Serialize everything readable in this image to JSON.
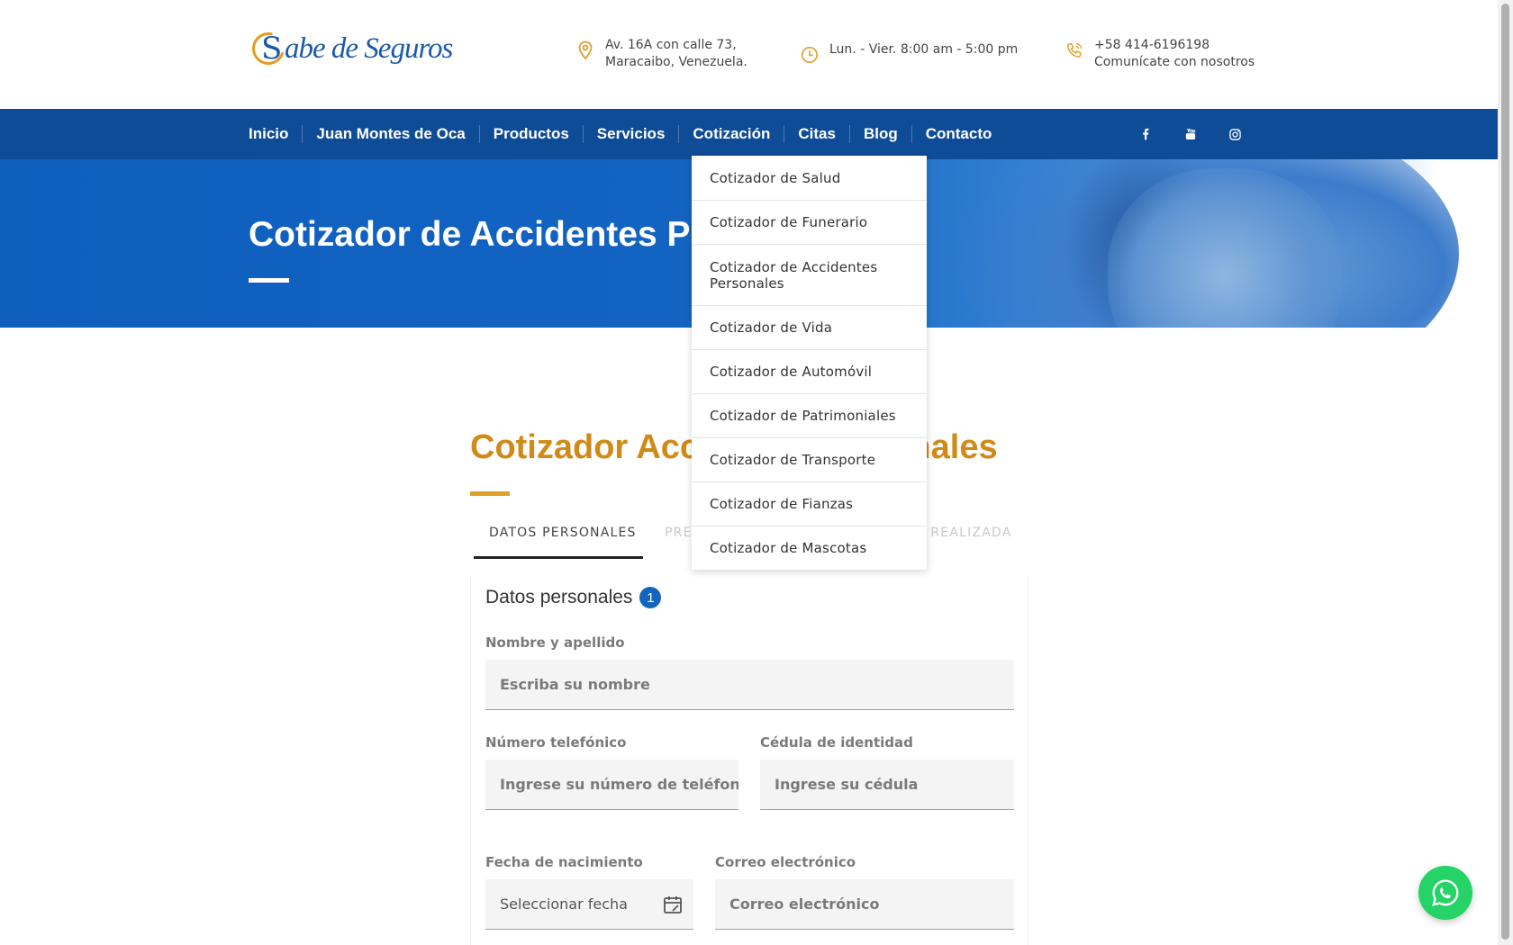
{
  "header": {
    "logo_text": "abe de Seguros",
    "logo_initial": "S",
    "address_line1": "Av. 16A con calle 73,",
    "address_line2": "Maracaibo, Venezuela.",
    "hours": "Lun. - Vier. 8:00 am - 5:00 pm",
    "phone": "+58 414-6196198",
    "phone_sub": "Comunícate con nosotros"
  },
  "nav": {
    "items": [
      "Inicio",
      "Juan Montes de Oca",
      "Productos",
      "Servicios",
      "Cotización",
      "Citas",
      "Blog",
      "Contacto"
    ],
    "social": [
      "facebook-icon",
      "youtube-icon",
      "instagram-icon"
    ]
  },
  "dropdown": {
    "items": [
      "Cotizador de Salud",
      "Cotizador de Funerario",
      "Cotizador de Accidentes Personales",
      "Cotizador de Vida",
      "Cotizador de Automóvil",
      "Cotizador de Patrimoniales",
      "Cotizador de Transporte",
      "Cotizador de Fianzas",
      "Cotizador de Mascotas"
    ]
  },
  "hero": {
    "title": "Cotizador de Accidentes P"
  },
  "main": {
    "title": "Cotizador Acc                    onales",
    "tabs": [
      "DATOS PERSONALES",
      "PRE",
      "N REALIZADA"
    ]
  },
  "form": {
    "section_title": "Datos personales",
    "step": "1",
    "name_label": "Nombre y apellido",
    "name_placeholder": "Escriba su nombre",
    "phone_label": "Número telefónico",
    "phone_placeholder": "Ingrese su número de teléfono",
    "id_label": "Cédula de identidad",
    "id_placeholder": "Ingrese su cédula",
    "birth_label": "Fecha de nacimiento",
    "birth_placeholder": "Seleccionar fecha",
    "email_label": "Correo electrónico",
    "email_placeholder": "Correo electrónico"
  },
  "colors": {
    "nav_blue": "#0f4c97",
    "accent_orange": "#d08a18",
    "whatsapp_green": "#25d366"
  }
}
